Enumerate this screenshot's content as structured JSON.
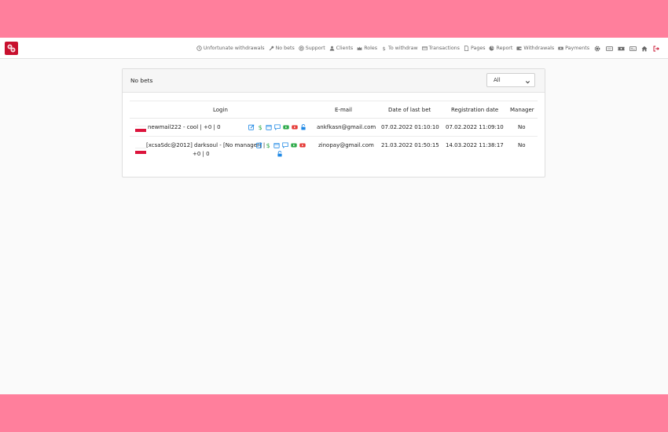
{
  "nav": {
    "items": [
      {
        "label": "Unfortunate withdrawals",
        "icon": "clock-icon"
      },
      {
        "label": "No bets",
        "icon": "wrench-icon"
      },
      {
        "label": "Support",
        "icon": "support-icon"
      },
      {
        "label": "Clients",
        "icon": "user-icon"
      },
      {
        "label": "Roles",
        "icon": "crown-icon"
      },
      {
        "label": "To withdraw",
        "icon": "dollar-icon"
      },
      {
        "label": "Transactions",
        "icon": "card-icon"
      },
      {
        "label": "Pages",
        "icon": "file-icon"
      },
      {
        "label": "Report",
        "icon": "chart-icon"
      },
      {
        "label": "Withdrawals",
        "icon": "wallet-icon"
      },
      {
        "label": "Payments",
        "icon": "money-icon"
      }
    ],
    "icons": [
      "gear-icon",
      "keyboard-icon",
      "ticket-icon",
      "id-card-icon",
      "home-icon",
      "logout-icon"
    ]
  },
  "card": {
    "title": "No bets",
    "filter": {
      "selected": "All"
    }
  },
  "table": {
    "headers": {
      "login": "Login",
      "email": "E-mail",
      "last_bet": "Date of last bet",
      "registration": "Registration date",
      "manager": "Manager"
    },
    "rows": [
      {
        "login": "newmail222 - cool | +0 | 0",
        "email": "ankfkasn@gmail.com",
        "last_bet": "07.02.2022 01:10:10",
        "registration": "07.02.2022 11:09:10",
        "manager": "No"
      },
      {
        "login_line1": "[xcsaSdc@2012] darksoul - [No manager] |",
        "login_line2": "+0 | 0",
        "email": "zinopay@gmail.com",
        "last_bet": "21.03.2022 01:50:15",
        "registration": "14.03.2022 11:38:17",
        "manager": "No"
      }
    ]
  },
  "colors": {
    "frame": "#ff7f9c",
    "brand": "#c8102e",
    "edit": "#1e88e5",
    "money": "#2eaa4a",
    "calendar": "#1e88e5",
    "message": "#1e88e5",
    "video_green": "#2eaa4a",
    "video_red": "#e53935",
    "lock": "#1e88e5"
  }
}
